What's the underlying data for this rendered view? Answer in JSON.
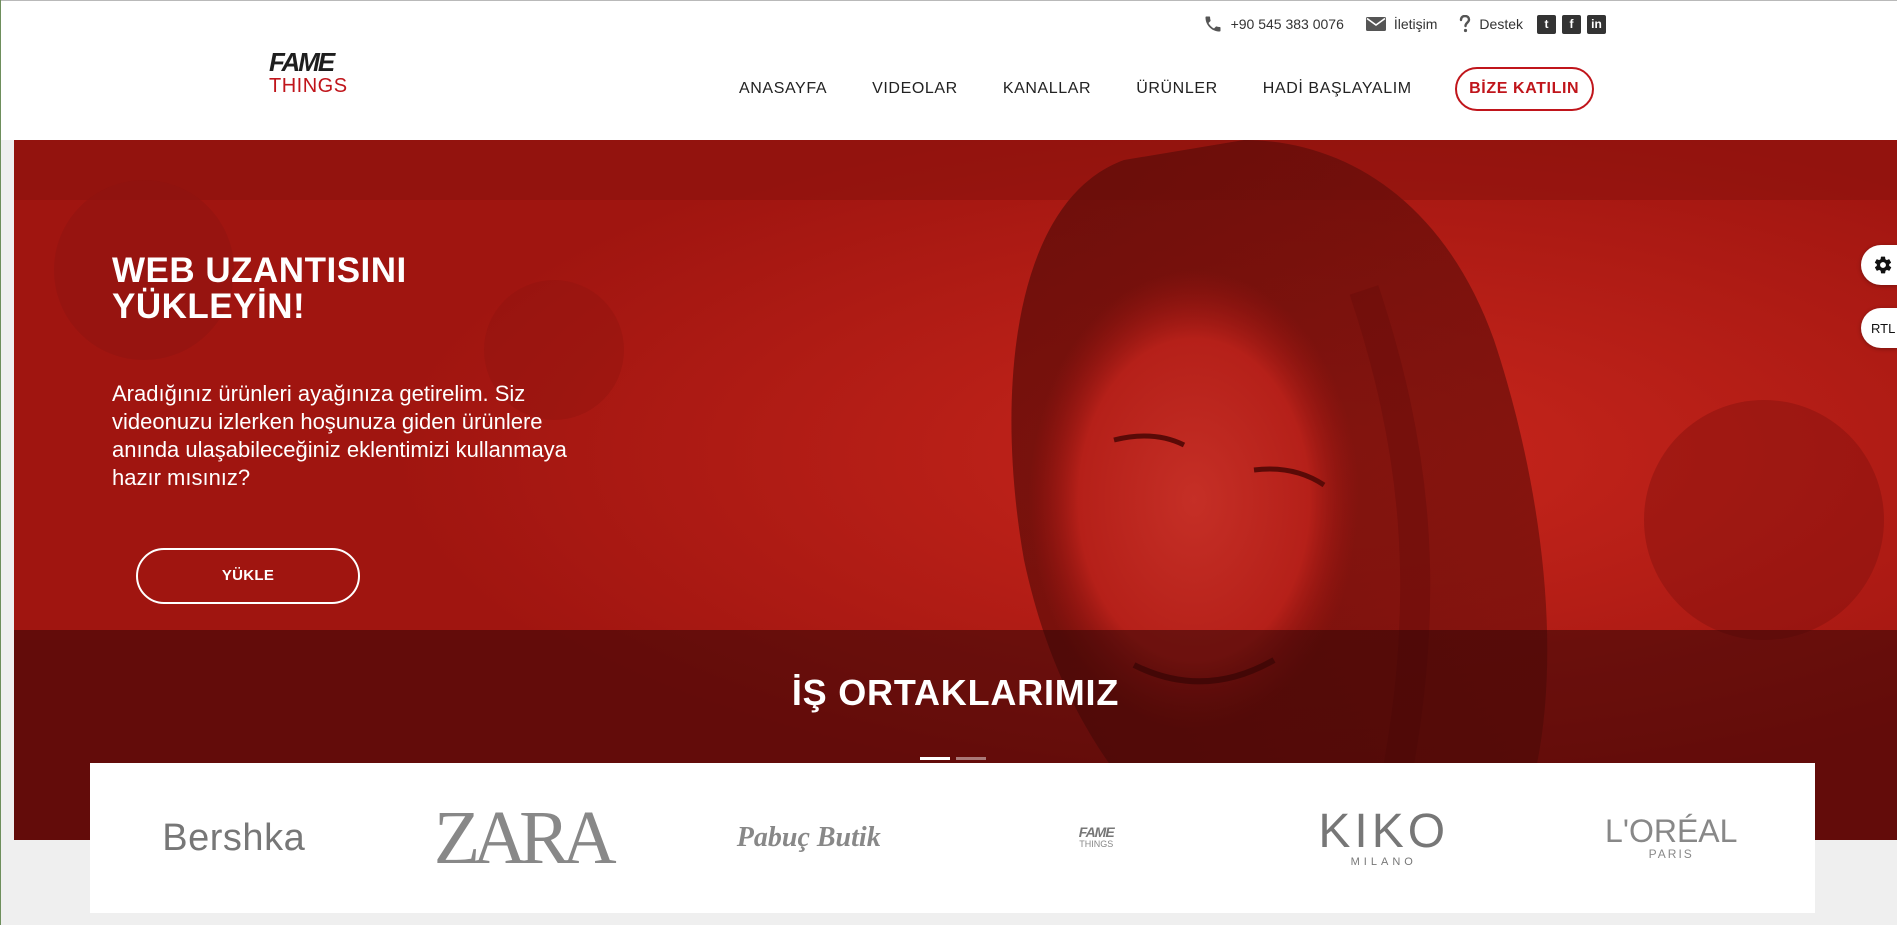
{
  "brand": {
    "logo_top": "FAME",
    "logo_bottom": "THINGS",
    "accent_color": "#c0151b"
  },
  "topbar": {
    "phone": "+90 545 383 0076",
    "contact": "İletişim",
    "support": "Destek",
    "social_icons": [
      "twitter-icon",
      "facebook-icon",
      "linkedin-icon"
    ]
  },
  "nav": {
    "items": [
      "ANASAYFA",
      "VIDEOLAR",
      "KANALLAR",
      "ÜRÜNLER",
      "HADİ BAŞLAYALIM"
    ],
    "cta": "BİZE KATILIN"
  },
  "hero": {
    "title": "WEB UZANTISINI\nYÜKLEYİN!",
    "text": "Aradığınız ürünleri ayağınıza getirelim. Siz videonuzu izlerken hoşunuza giden ürünlere anında ulaşabileceğiniz eklentimizi kullanmaya hazır mısınız?",
    "button": "YÜKLE"
  },
  "partners": {
    "title": "İŞ ORTAKLARIMIZ",
    "logos": {
      "bershka": "Bershka",
      "zara": "ZARA",
      "pabuc": "Pabuç Butik",
      "fame_top": "FAME",
      "fame_bottom": "THINGS",
      "kiko_top": "KIKO",
      "kiko_bottom": "MILANO",
      "loreal_top": "L'ORÉAL",
      "loreal_bottom": "PARIS"
    },
    "slider_active_index": 0
  },
  "side": {
    "rtl": "RTL"
  }
}
